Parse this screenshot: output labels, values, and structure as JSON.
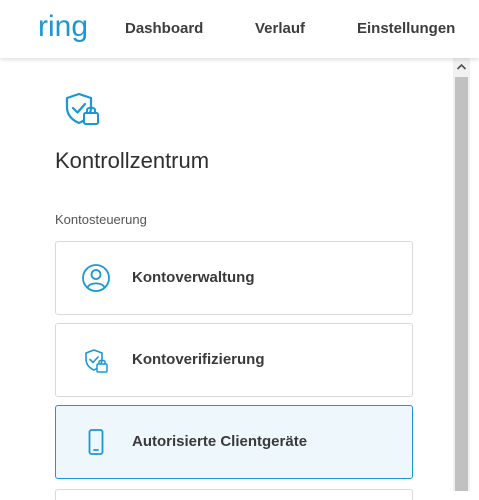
{
  "header": {
    "logo_text": "ring",
    "nav": [
      {
        "label": "Dashboard"
      },
      {
        "label": "Verlauf"
      },
      {
        "label": "Einstellungen"
      }
    ]
  },
  "page": {
    "title": "Kontrollzentrum",
    "section_label": "Kontosteuerung",
    "cards": [
      {
        "label": "Kontoverwaltung",
        "icon": "person-circle-icon"
      },
      {
        "label": "Kontoverifizierung",
        "icon": "shield-check-lock-icon"
      },
      {
        "label": "Autorisierte Clientgeräte",
        "icon": "mobile-phone-icon",
        "selected": true
      }
    ]
  },
  "colors": {
    "accent": "#1998d5",
    "selected_bg": "#eef7fc",
    "text": "#3a3a3a"
  }
}
